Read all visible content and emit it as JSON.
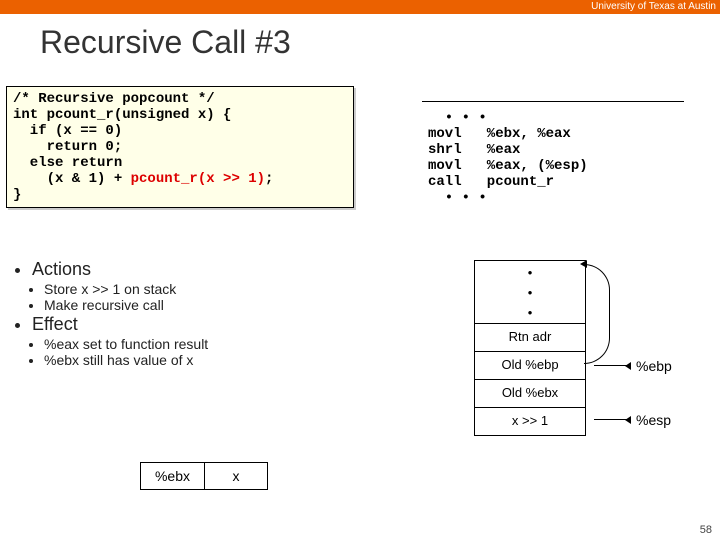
{
  "header": {
    "uni": "University of Texas at Austin"
  },
  "title": "Recursive Call #3",
  "code": {
    "c1": "/* Recursive popcount */",
    "c2": "int pcount_r(unsigned x) {",
    "c3": "  if (x == 0)",
    "c4": "    return 0;",
    "c5": "  else return",
    "c6a": "    (x & 1) + ",
    "c6b": "pcount_r(x >> 1)",
    "c6c": ";",
    "c7": "}"
  },
  "asm": {
    "a0": "  • • •",
    "a1": "movl   %ebx, %eax",
    "a2": "shrl   %eax",
    "a3": "movl   %eax, (%esp)",
    "a4": "call   pcount_r",
    "a5": "  • • •"
  },
  "bullets": {
    "actions_h": "Actions",
    "actions_1": "Store x >> 1 on stack",
    "actions_2": "Make recursive call",
    "effect_h": "Effect",
    "effect_1": "%eax set to function result",
    "effect_2": "%ebx still has value of x"
  },
  "stack": {
    "dot": "•",
    "rtn": "Rtn adr",
    "oldebp": "Old %ebp",
    "oldebx": "Old %ebx",
    "xshr": "x >> 1",
    "ebp_lbl": "%ebp",
    "esp_lbl": "%esp"
  },
  "reg": {
    "name": "%ebx",
    "val": "x"
  },
  "pagenum": "58"
}
